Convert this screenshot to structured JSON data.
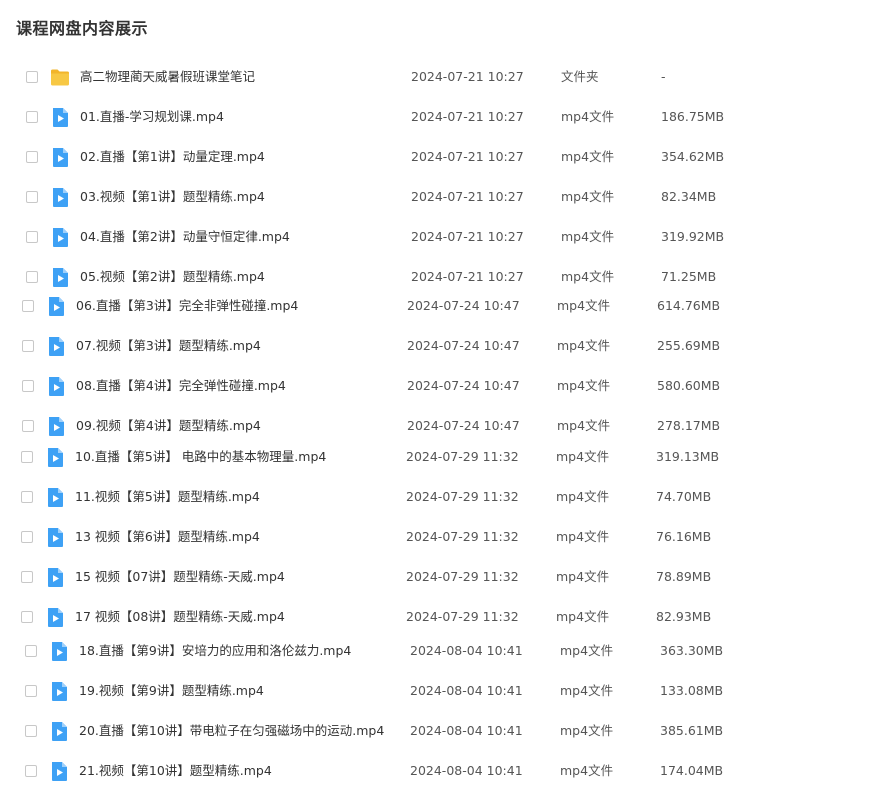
{
  "page": {
    "title": "课程网盘内容展示"
  },
  "colors": {
    "folder": "#f7c844",
    "video": "#3ea1f5",
    "text": "#333333"
  },
  "files": [
    {
      "icon": "folder-icon",
      "name": "高二物理蔺天威暑假班课堂笔记",
      "date": "2024-07-21 10:27",
      "type": "文件夹",
      "size": "-"
    },
    {
      "icon": "video-file-icon",
      "name": "01.直播-学习规划课.mp4",
      "date": "2024-07-21 10:27",
      "type": "mp4文件",
      "size": "186.75MB"
    },
    {
      "icon": "video-file-icon",
      "name": "02.直播【第1讲】动量定理.mp4",
      "date": "2024-07-21 10:27",
      "type": "mp4文件",
      "size": "354.62MB"
    },
    {
      "icon": "video-file-icon",
      "name": "03.视频【第1讲】题型精练.mp4",
      "date": "2024-07-21 10:27",
      "type": "mp4文件",
      "size": "82.34MB"
    },
    {
      "icon": "video-file-icon",
      "name": "04.直播【第2讲】动量守恒定律.mp4",
      "date": "2024-07-21 10:27",
      "type": "mp4文件",
      "size": "319.92MB"
    },
    {
      "icon": "video-file-icon",
      "name": "05.视频【第2讲】题型精练.mp4",
      "date": "2024-07-21 10:27",
      "type": "mp4文件",
      "size": "71.25MB"
    },
    {
      "icon": "video-file-icon",
      "name": "06.直播【第3讲】完全非弹性碰撞.mp4",
      "date": "2024-07-24 10:47",
      "type": "mp4文件",
      "size": "614.76MB"
    },
    {
      "icon": "video-file-icon",
      "name": "07.视频【第3讲】题型精练.mp4",
      "date": "2024-07-24 10:47",
      "type": "mp4文件",
      "size": "255.69MB"
    },
    {
      "icon": "video-file-icon",
      "name": "08.直播【第4讲】完全弹性碰撞.mp4",
      "date": "2024-07-24 10:47",
      "type": "mp4文件",
      "size": "580.60MB"
    },
    {
      "icon": "video-file-icon",
      "name": "09.视频【第4讲】题型精练.mp4",
      "date": "2024-07-24 10:47",
      "type": "mp4文件",
      "size": "278.17MB"
    },
    {
      "icon": "video-file-icon",
      "name": "10.直播【第5讲】 电路中的基本物理量.mp4",
      "date": "2024-07-29 11:32",
      "type": "mp4文件",
      "size": "319.13MB"
    },
    {
      "icon": "video-file-icon",
      "name": "11.视频【第5讲】题型精练.mp4",
      "date": "2024-07-29 11:32",
      "type": "mp4文件",
      "size": "74.70MB"
    },
    {
      "icon": "video-file-icon",
      "name": "13 视频【第6讲】题型精练.mp4",
      "date": "2024-07-29 11:32",
      "type": "mp4文件",
      "size": "76.16MB"
    },
    {
      "icon": "video-file-icon",
      "name": "15 视频【07讲】题型精练-天威.mp4",
      "date": "2024-07-29 11:32",
      "type": "mp4文件",
      "size": "78.89MB"
    },
    {
      "icon": "video-file-icon",
      "name": "17 视频【08讲】题型精练-天威.mp4",
      "date": "2024-07-29 11:32",
      "type": "mp4文件",
      "size": "82.93MB"
    },
    {
      "icon": "video-file-icon",
      "name": "18.直播【第9讲】安培力的应用和洛伦兹力.mp4",
      "date": "2024-08-04 10:41",
      "type": "mp4文件",
      "size": "363.30MB"
    },
    {
      "icon": "video-file-icon",
      "name": "19.视频【第9讲】题型精练.mp4",
      "date": "2024-08-04 10:41",
      "type": "mp4文件",
      "size": "133.08MB"
    },
    {
      "icon": "video-file-icon",
      "name": "20.直播【第10讲】带电粒子在匀强磁场中的运动.mp4",
      "date": "2024-08-04 10:41",
      "type": "mp4文件",
      "size": "385.61MB"
    },
    {
      "icon": "video-file-icon",
      "name": "21.视频【第10讲】题型精练.mp4",
      "date": "2024-08-04 10:41",
      "type": "mp4文件",
      "size": "174.04MB"
    }
  ]
}
